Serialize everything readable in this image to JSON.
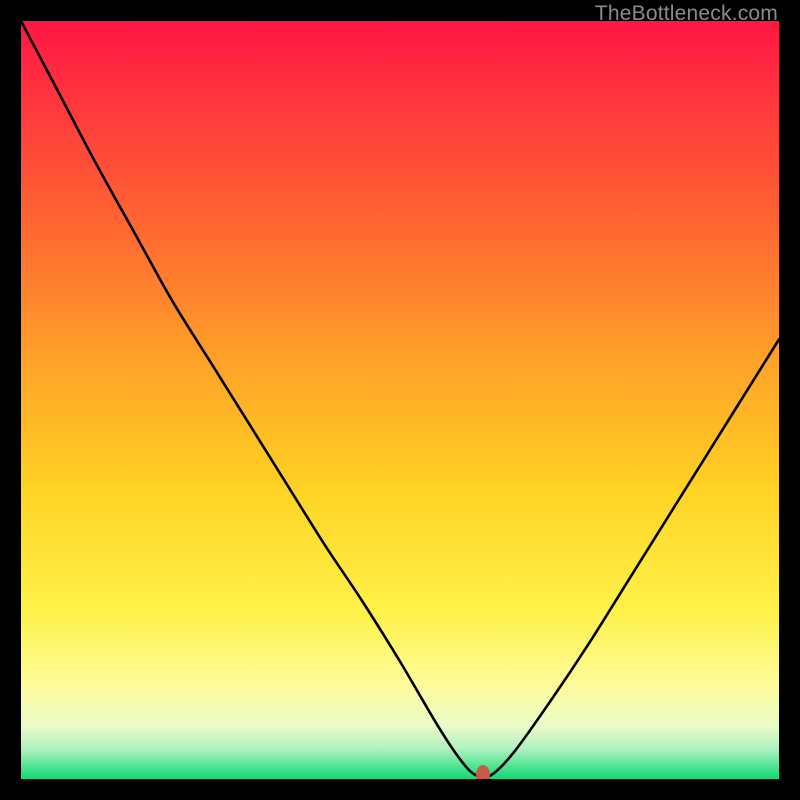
{
  "watermark": "TheBottleneck.com",
  "chart_data": {
    "type": "line",
    "title": "",
    "xlabel": "",
    "ylabel": "",
    "xlim": [
      0,
      100
    ],
    "ylim": [
      0,
      100
    ],
    "x": [
      0,
      5,
      10,
      15,
      20,
      25,
      30,
      35,
      40,
      45,
      50,
      55,
      58,
      60,
      62,
      65,
      70,
      75,
      80,
      85,
      90,
      95,
      100
    ],
    "y": [
      100,
      90.5,
      81,
      72,
      63,
      55,
      47,
      39,
      31,
      23.5,
      15.5,
      7,
      2.5,
      0.5,
      0.5,
      3.5,
      10.5,
      18,
      26,
      34,
      42,
      50,
      58
    ],
    "marker": {
      "x": 61,
      "y": 0.5,
      "color": "#c65a47"
    },
    "gradient_stops": [
      {
        "pct": 0,
        "color": "#ff1644"
      },
      {
        "pct": 12,
        "color": "#ff3a3c"
      },
      {
        "pct": 28,
        "color": "#ff6a31"
      },
      {
        "pct": 45,
        "color": "#ffa228"
      },
      {
        "pct": 62,
        "color": "#ffd324"
      },
      {
        "pct": 78,
        "color": "#fff24a"
      },
      {
        "pct": 88,
        "color": "#fdfc9e"
      },
      {
        "pct": 93,
        "color": "#e9fbc6"
      },
      {
        "pct": 96,
        "color": "#b0f1c2"
      },
      {
        "pct": 98.5,
        "color": "#49e38f"
      },
      {
        "pct": 100,
        "color": "#13d877"
      }
    ]
  }
}
